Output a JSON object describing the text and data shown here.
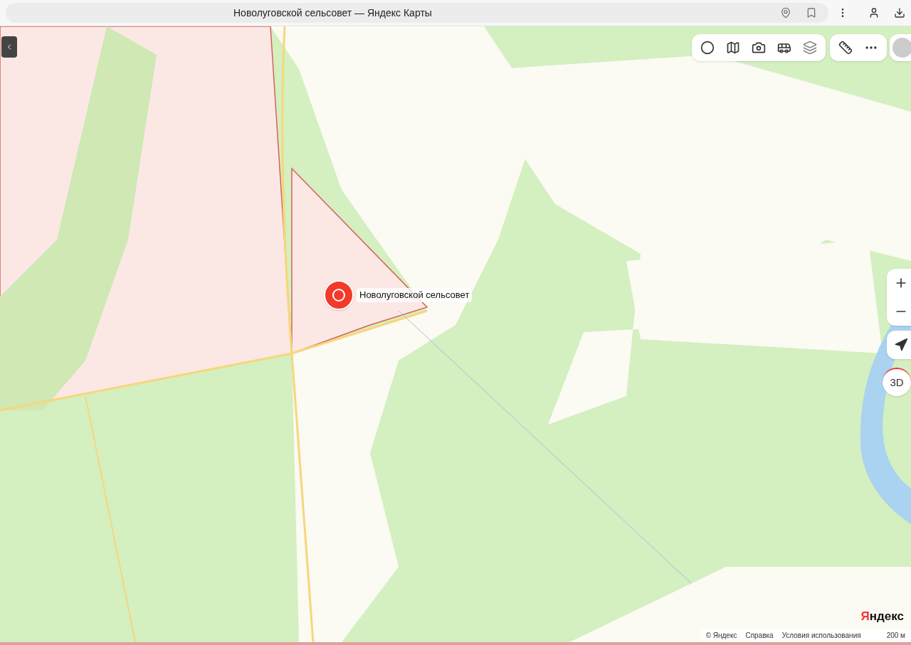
{
  "browser": {
    "title": "Новолуговской сельсовет — Яндекс Карты"
  },
  "map": {
    "marker": {
      "label": "Новолуговской сельсовет"
    },
    "compass": {
      "label": "3D"
    },
    "attribution": {
      "copyright": "© Яндекс",
      "links": [
        "Справка",
        "Условия использования"
      ],
      "scale": "200 м",
      "logo": "Яндекс"
    }
  }
}
